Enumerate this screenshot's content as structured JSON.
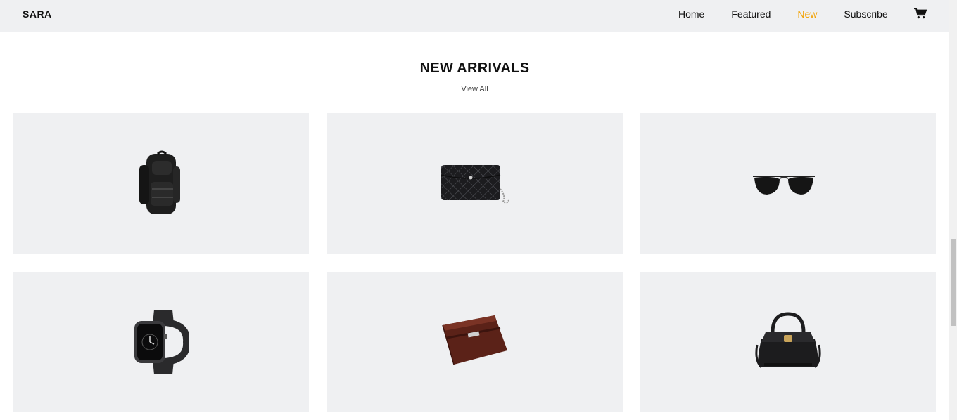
{
  "header": {
    "brand": "SARA",
    "nav": [
      {
        "label": "Home",
        "active": false
      },
      {
        "label": "Featured",
        "active": false
      },
      {
        "label": "New",
        "active": true
      },
      {
        "label": "Subscribe",
        "active": false
      }
    ],
    "cart_icon": "cart-icon",
    "accent_color": "#f2a100"
  },
  "section": {
    "title": "NEW ARRIVALS",
    "view_all": "View All"
  },
  "products": [
    {
      "icon": "backpack-image"
    },
    {
      "icon": "quilted-clutch-image"
    },
    {
      "icon": "aviator-sunglasses-image"
    },
    {
      "icon": "smartwatch-image"
    },
    {
      "icon": "wallet-image"
    },
    {
      "icon": "handbag-image"
    }
  ]
}
